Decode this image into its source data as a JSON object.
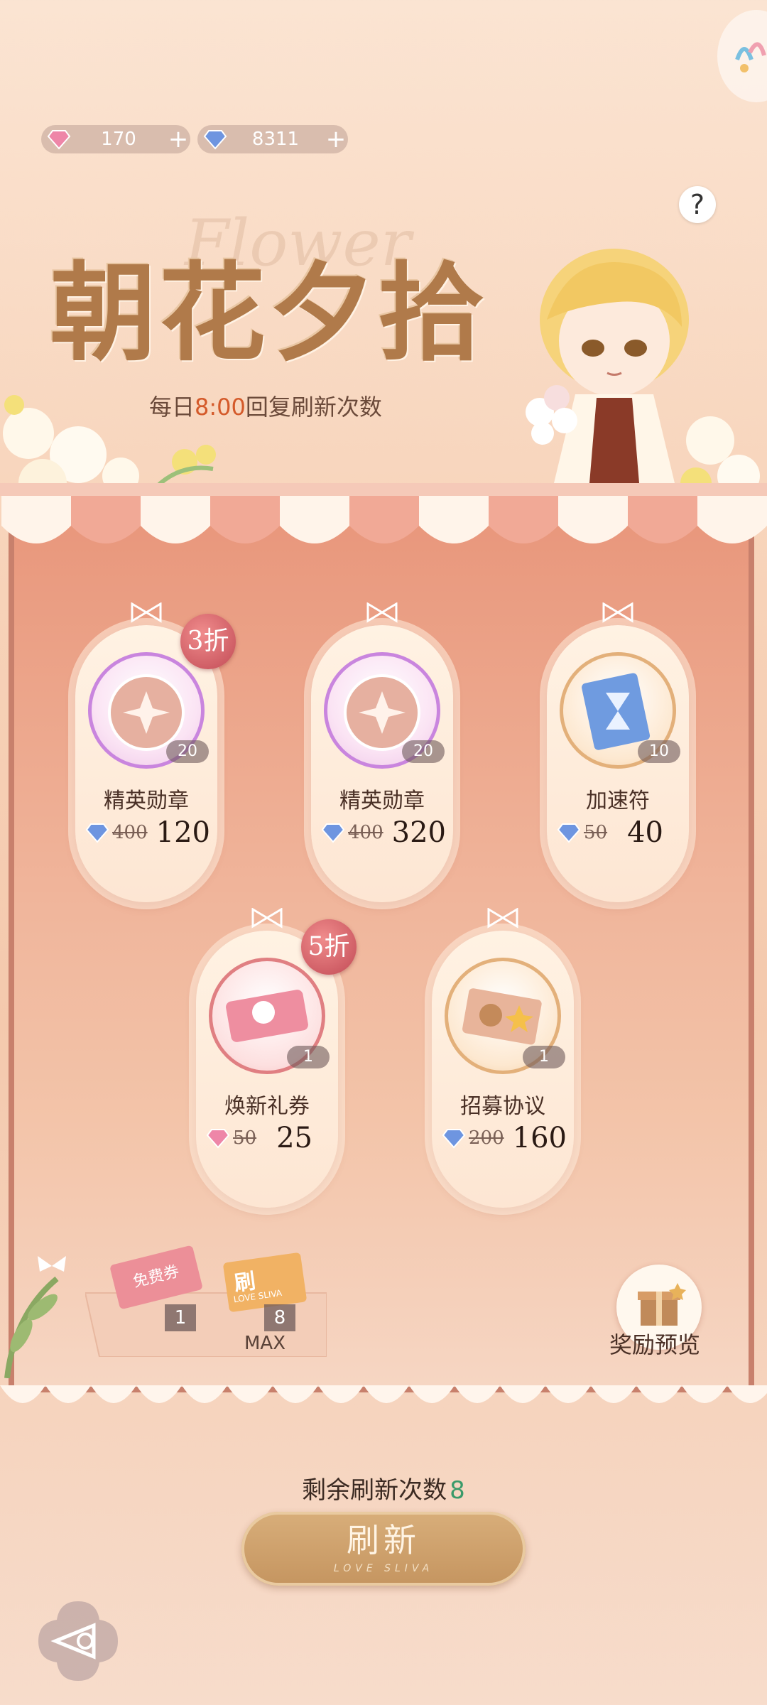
{
  "currency": {
    "pink_value": "170",
    "blue_value": "8311",
    "pink_color": "#e86a92",
    "blue_color": "#5b86d6"
  },
  "help": "?",
  "title": {
    "main": "朝花夕拾",
    "deco": "Flower",
    "subtitle_pre": "每日",
    "subtitle_time": "8:00",
    "subtitle_post": "回复刷新次数"
  },
  "items": [
    {
      "name": "精英勋章",
      "count": "20",
      "old": "400",
      "new": "120",
      "badge": "3折",
      "currency": "blue"
    },
    {
      "name": "精英勋章",
      "count": "20",
      "old": "400",
      "new": "320",
      "badge": "",
      "currency": "blue"
    },
    {
      "name": "加速符",
      "count": "10",
      "old": "50",
      "new": "40",
      "badge": "",
      "currency": "blue"
    },
    {
      "name": "焕新礼券",
      "count": "1",
      "old": "50",
      "new": "25",
      "badge": "5折",
      "currency": "pink"
    },
    {
      "name": "招募协议",
      "count": "1",
      "old": "200",
      "new": "160",
      "badge": "",
      "currency": "blue"
    }
  ],
  "tickets": {
    "free_label": "免费券",
    "free_count": "1",
    "refresh_label": "刷",
    "refresh_count": "8",
    "max_label": "MAX",
    "brand": "LOVE SLIVA"
  },
  "reward_label": "奖励预览",
  "remaining": {
    "label": "剩余刷新次数",
    "value": "8"
  },
  "refresh_button": {
    "label": "刷新",
    "sub": "LOVE SLIVA"
  }
}
